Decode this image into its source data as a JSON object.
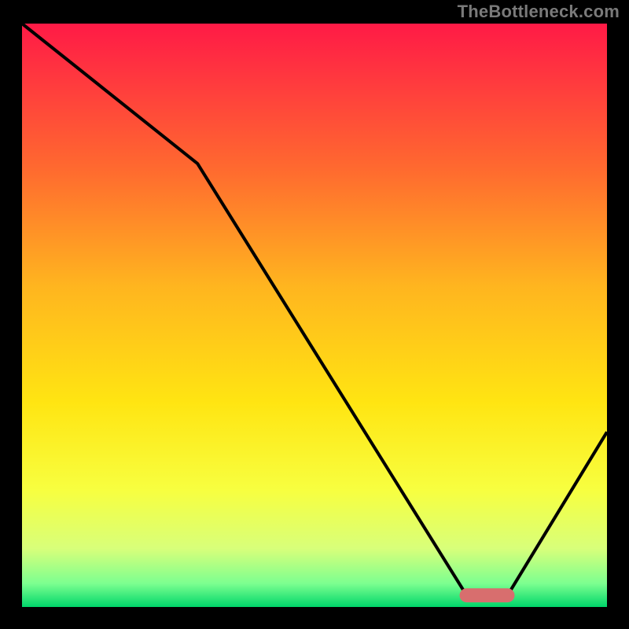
{
  "watermark": "TheBottleneck.com",
  "chart_data": {
    "type": "line",
    "title": "",
    "xlabel": "",
    "ylabel": "",
    "xlim": [
      0,
      100
    ],
    "ylim": [
      0,
      100
    ],
    "series": [
      {
        "name": "bottleneck-curve",
        "x": [
          0,
          30,
          76,
          83,
          100
        ],
        "y": [
          100,
          76,
          2,
          2,
          30
        ]
      }
    ],
    "gradient_stops": [
      {
        "offset": 0.0,
        "color": "#ff1a46"
      },
      {
        "offset": 0.1,
        "color": "#ff3a3e"
      },
      {
        "offset": 0.25,
        "color": "#ff6a2f"
      },
      {
        "offset": 0.45,
        "color": "#ffb51f"
      },
      {
        "offset": 0.65,
        "color": "#ffe512"
      },
      {
        "offset": 0.8,
        "color": "#f7ff40"
      },
      {
        "offset": 0.9,
        "color": "#d8ff7a"
      },
      {
        "offset": 0.96,
        "color": "#7CFF90"
      },
      {
        "offset": 1.0,
        "color": "#00d66a"
      }
    ],
    "marker": {
      "x_start": 76,
      "x_end": 83,
      "y": 2,
      "color": "#d86e6e",
      "thickness": 2.4
    },
    "curve_color": "#000000",
    "curve_width": 0.55
  }
}
